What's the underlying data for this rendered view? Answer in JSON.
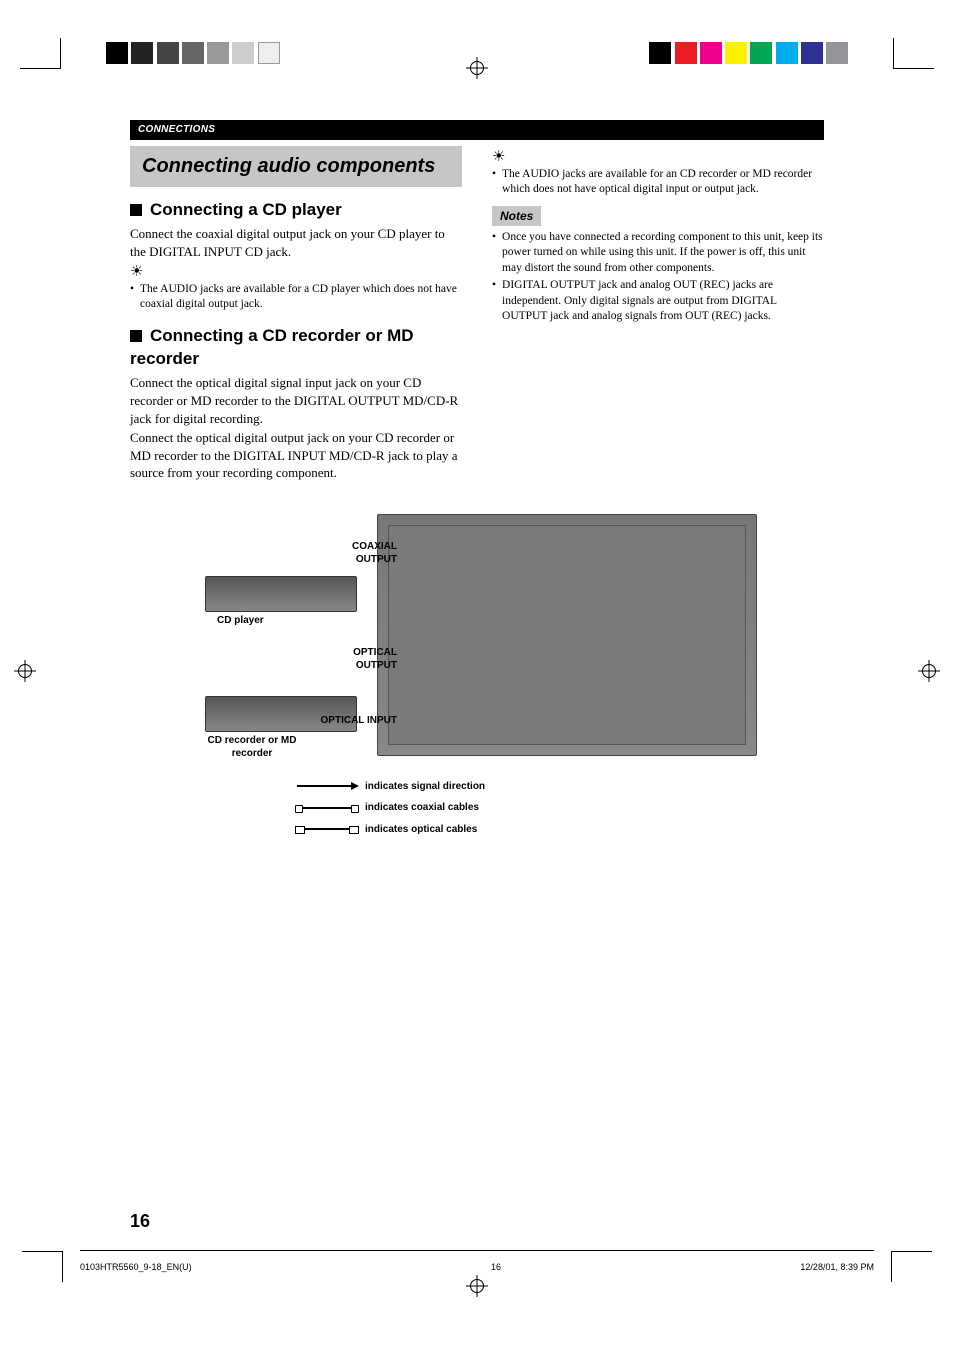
{
  "header_bar": "CONNECTIONS",
  "title_band": "Connecting audio components",
  "left_col": {
    "section1": {
      "heading": "Connecting a CD player",
      "body": "Connect the coaxial digital output jack on your CD player to the DIGITAL INPUT CD jack.",
      "tip_bullet": "The AUDIO jacks are available for a CD player which does not have coaxial digital output jack."
    },
    "section2": {
      "heading": "Connecting a CD recorder or MD recorder",
      "body1": "Connect the optical digital signal input jack on your CD recorder or MD recorder to the DIGITAL OUTPUT MD/CD-R jack for digital recording.",
      "body2": "Connect the optical digital output jack on your CD recorder or MD recorder to the DIGITAL INPUT MD/CD-R jack to play a source from your recording component."
    }
  },
  "right_col": {
    "tip_bullet": "The AUDIO jacks are available for an CD recorder or MD recorder which does not have optical digital input or output jack.",
    "notes_label": "Notes",
    "notes": [
      "Once you have connected a recording component to this unit, keep its power turned on while using this unit. If the power is off, this unit may distort the sound from other components.",
      "DIGITAL OUTPUT jack and analog OUT (REC) jacks are independent. Only digital signals are output from DIGITAL OUTPUT jack and analog signals from OUT (REC) jacks."
    ]
  },
  "figure": {
    "coax_label": "COAXIAL OUTPUT",
    "cd_player_label": "CD player",
    "optical_output_label": "OPTICAL OUTPUT",
    "optical_input_label": "OPTICAL INPUT",
    "cd_recorder_label": "CD recorder or MD recorder"
  },
  "legend": {
    "signal": "indicates signal direction",
    "coax": "indicates coaxial cables",
    "optical": "indicates optical cables"
  },
  "page_number": "16",
  "footer": {
    "file": "0103HTR5560_9-18_EN(U)",
    "page": "16",
    "timestamp": "12/28/01, 8:39 PM"
  },
  "cal_colors_right": [
    "#000",
    "#f00",
    "#f0f",
    "#ff0",
    "#0f0",
    "#0ff",
    "#00f",
    "#888"
  ],
  "cal_colors_left_count": 7
}
